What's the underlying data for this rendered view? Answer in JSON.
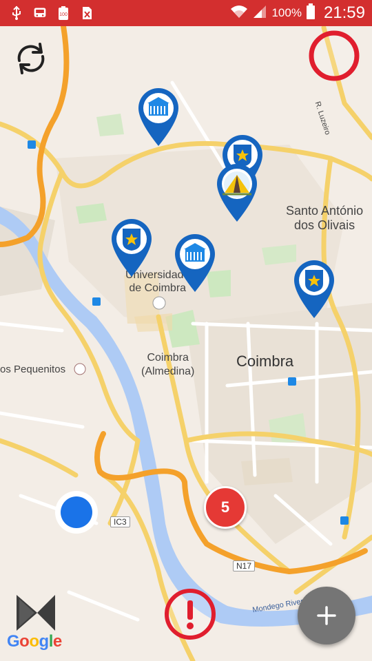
{
  "status_bar": {
    "battery_percent": "100%",
    "time": "21:59",
    "background": "#d32f2f"
  },
  "map": {
    "place_labels": {
      "santo_antonio": "Santo António\ndos Olivais",
      "universidade": "Universidade\nde Coimbra",
      "coimbra_almedina": "Coimbra\n(Almedina)",
      "coimbra": "Coimbra",
      "pequenitos": "os Pequenitos"
    },
    "road_labels": {
      "r_luzeiro": "R. Luzeiro",
      "ic3": "IC3",
      "n17": "N17",
      "mondego_river": "Mondego River"
    },
    "attribution": "Google"
  },
  "controls": {
    "refresh_icon": "refresh-icon",
    "stop_icon": "circle-outline-icon",
    "alert_icon": "exclamation-circle-icon",
    "add_icon": "plus-icon",
    "cluster_count": "5",
    "accent_red": "#e01e2e",
    "marker_blue": "#1565c0"
  },
  "markers": [
    {
      "icon": "building-icon"
    },
    {
      "icon": "police-badge-icon"
    },
    {
      "icon": "tent-icon"
    },
    {
      "icon": "police-badge-icon"
    },
    {
      "icon": "building-icon"
    },
    {
      "icon": "police-badge-icon"
    }
  ]
}
